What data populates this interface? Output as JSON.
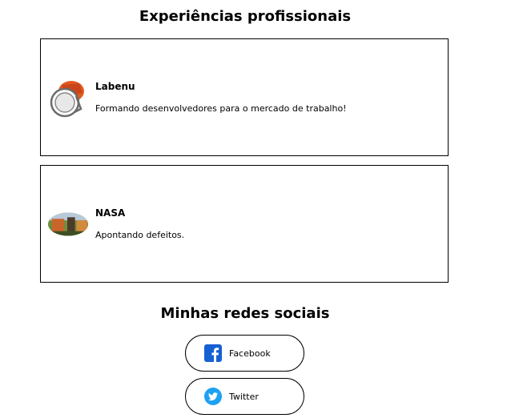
{
  "experience": {
    "title": "Experiências profissionais",
    "items": [
      {
        "name": "Labenu",
        "description": "Formando desenvolvedores para o mercado de trabalho!",
        "logo_icon": "labenu-logo"
      },
      {
        "name": "NASA",
        "description": "Apontando defeitos.",
        "logo_icon": "nasa-photo"
      }
    ]
  },
  "social": {
    "title": "Minhas redes sociais",
    "links": [
      {
        "label": "Facebook",
        "icon": "facebook-icon",
        "color": "#1877f2"
      },
      {
        "label": "Twitter",
        "icon": "twitter-icon",
        "color": "#1da1f2"
      }
    ]
  }
}
